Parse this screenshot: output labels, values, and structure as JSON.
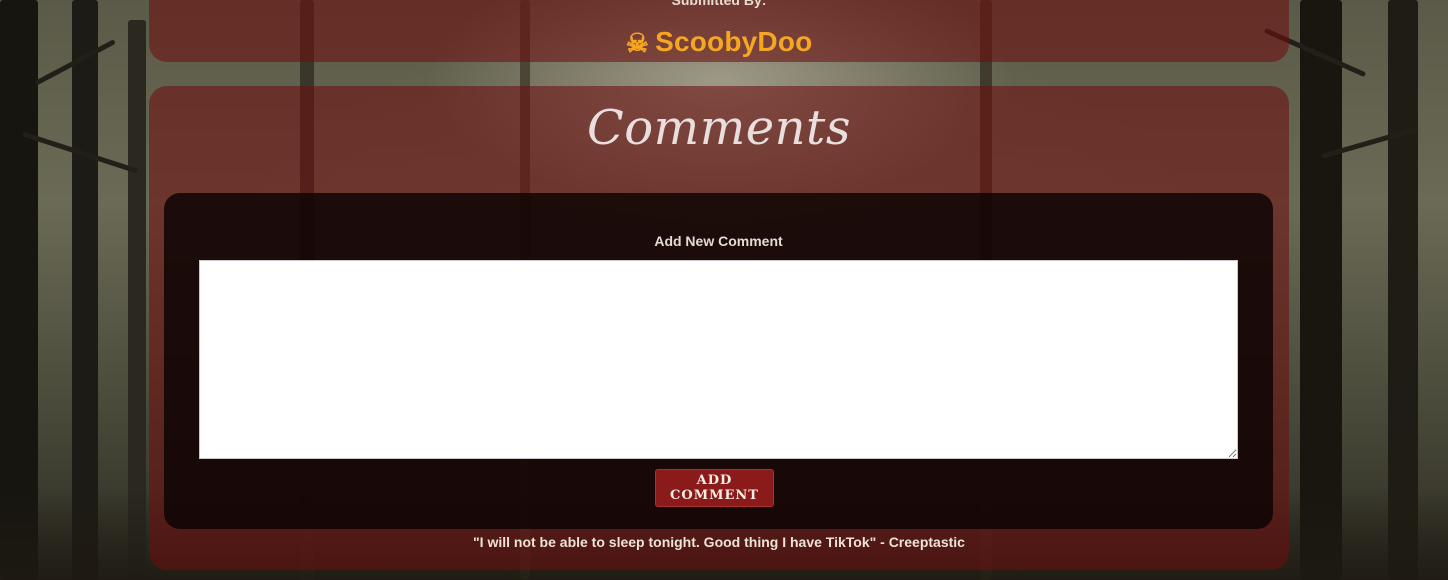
{
  "submission": {
    "submitted_by_label": "Submitted By:",
    "author_icon": "skull-crossbones-icon",
    "author_icon_glyph": "☠",
    "author_name": "ScoobyDoo"
  },
  "comments": {
    "title": "Comments",
    "add_label": "Add New Comment",
    "textarea_value": "",
    "button_label": "Add Comment"
  },
  "footer": {
    "quote": "\"I will not be able to sleep tonight. Good thing I have TikTok\" - Creeptastic"
  },
  "colors": {
    "panel": "#6c0f0f",
    "author": "#f5a623",
    "button": "#8b1a1a",
    "dark_box": "#0c0403"
  }
}
